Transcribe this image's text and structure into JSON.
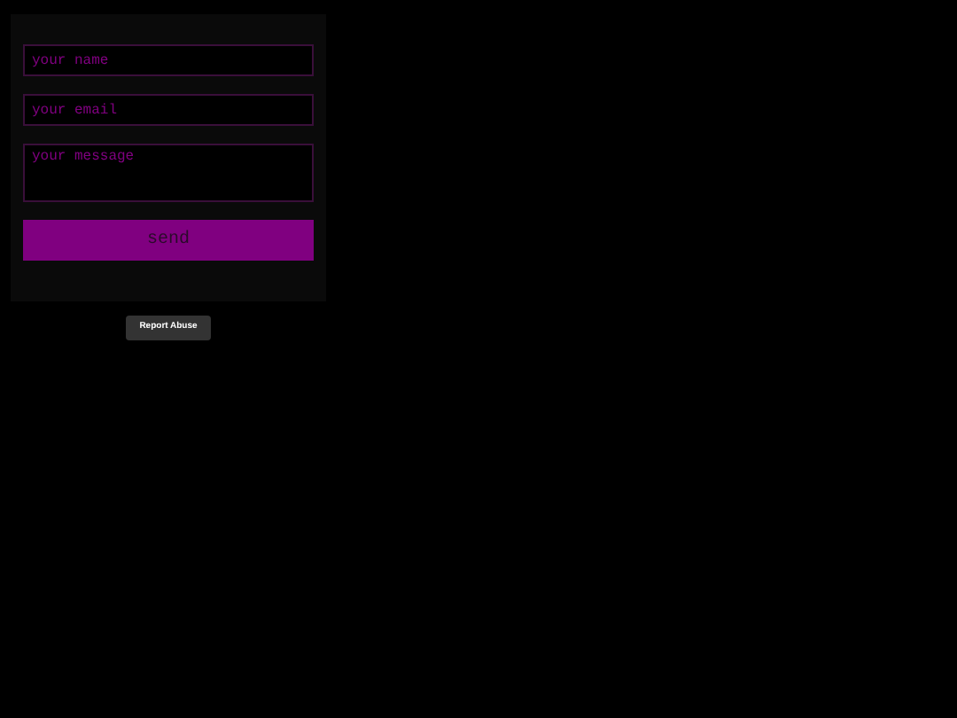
{
  "form": {
    "name": {
      "placeholder": "your name"
    },
    "email": {
      "placeholder": "your email"
    },
    "message": {
      "placeholder": "your message"
    },
    "submit": "send"
  },
  "report_button": "Report Abuse"
}
